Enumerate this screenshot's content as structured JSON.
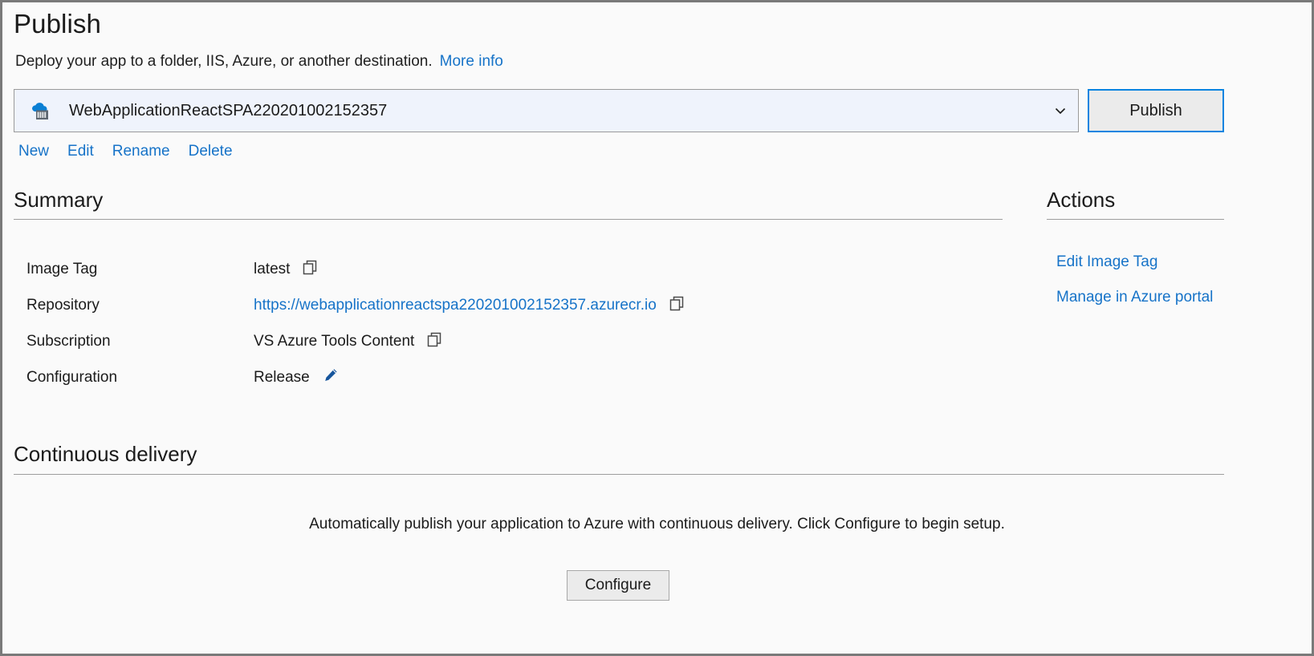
{
  "header": {
    "title": "Publish",
    "subtitle": "Deploy your app to a folder, IIS, Azure, or another destination.",
    "more_info_label": "More info"
  },
  "profile": {
    "selected": "WebApplicationReactSPA220201002152357",
    "icon": "azure-container-registry-icon",
    "publish_button_label": "Publish",
    "links": [
      {
        "label": "New"
      },
      {
        "label": "Edit"
      },
      {
        "label": "Rename"
      },
      {
        "label": "Delete"
      }
    ]
  },
  "summary": {
    "heading": "Summary",
    "rows": [
      {
        "label": "Image Tag",
        "value": "latest",
        "is_link": false,
        "action_icon": "copy-icon"
      },
      {
        "label": "Repository",
        "value": "https://webapplicationreactspa220201002152357.azurecr.io",
        "is_link": true,
        "action_icon": "copy-icon"
      },
      {
        "label": "Subscription",
        "value": "VS Azure Tools Content",
        "is_link": false,
        "action_icon": "copy-icon"
      },
      {
        "label": "Configuration",
        "value": "Release",
        "is_link": false,
        "action_icon": "pencil-icon"
      }
    ]
  },
  "actions": {
    "heading": "Actions",
    "items": [
      {
        "label": "Edit Image Tag"
      },
      {
        "label": "Manage in Azure portal"
      }
    ]
  },
  "continuous_delivery": {
    "heading": "Continuous delivery",
    "message": "Automatically publish your application to Azure with continuous delivery. Click Configure to begin setup.",
    "configure_button_label": "Configure"
  },
  "colors": {
    "link": "#1673c8",
    "accent_focus": "#0a84e0",
    "window_border": "#7a7a7a",
    "page_background": "#fafafa",
    "select_background": "#eff3fc",
    "button_background": "#ebebeb",
    "rule": "#9d9d9d"
  }
}
